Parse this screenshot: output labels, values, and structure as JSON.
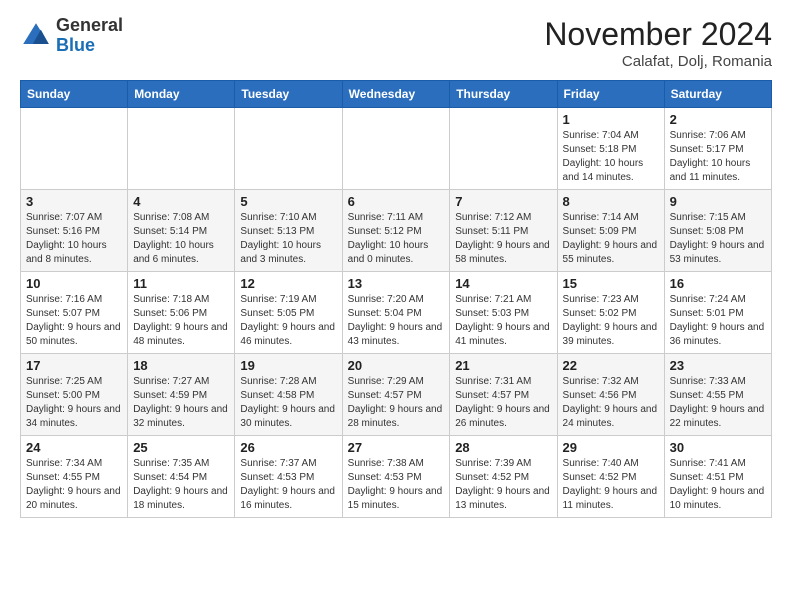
{
  "header": {
    "logo_general": "General",
    "logo_blue": "Blue",
    "month_year": "November 2024",
    "location": "Calafat, Dolj, Romania"
  },
  "days_of_week": [
    "Sunday",
    "Monday",
    "Tuesday",
    "Wednesday",
    "Thursday",
    "Friday",
    "Saturday"
  ],
  "weeks": [
    [
      {
        "day": "",
        "info": ""
      },
      {
        "day": "",
        "info": ""
      },
      {
        "day": "",
        "info": ""
      },
      {
        "day": "",
        "info": ""
      },
      {
        "day": "",
        "info": ""
      },
      {
        "day": "1",
        "info": "Sunrise: 7:04 AM\nSunset: 5:18 PM\nDaylight: 10 hours and 14 minutes."
      },
      {
        "day": "2",
        "info": "Sunrise: 7:06 AM\nSunset: 5:17 PM\nDaylight: 10 hours and 11 minutes."
      }
    ],
    [
      {
        "day": "3",
        "info": "Sunrise: 7:07 AM\nSunset: 5:16 PM\nDaylight: 10 hours and 8 minutes."
      },
      {
        "day": "4",
        "info": "Sunrise: 7:08 AM\nSunset: 5:14 PM\nDaylight: 10 hours and 6 minutes."
      },
      {
        "day": "5",
        "info": "Sunrise: 7:10 AM\nSunset: 5:13 PM\nDaylight: 10 hours and 3 minutes."
      },
      {
        "day": "6",
        "info": "Sunrise: 7:11 AM\nSunset: 5:12 PM\nDaylight: 10 hours and 0 minutes."
      },
      {
        "day": "7",
        "info": "Sunrise: 7:12 AM\nSunset: 5:11 PM\nDaylight: 9 hours and 58 minutes."
      },
      {
        "day": "8",
        "info": "Sunrise: 7:14 AM\nSunset: 5:09 PM\nDaylight: 9 hours and 55 minutes."
      },
      {
        "day": "9",
        "info": "Sunrise: 7:15 AM\nSunset: 5:08 PM\nDaylight: 9 hours and 53 minutes."
      }
    ],
    [
      {
        "day": "10",
        "info": "Sunrise: 7:16 AM\nSunset: 5:07 PM\nDaylight: 9 hours and 50 minutes."
      },
      {
        "day": "11",
        "info": "Sunrise: 7:18 AM\nSunset: 5:06 PM\nDaylight: 9 hours and 48 minutes."
      },
      {
        "day": "12",
        "info": "Sunrise: 7:19 AM\nSunset: 5:05 PM\nDaylight: 9 hours and 46 minutes."
      },
      {
        "day": "13",
        "info": "Sunrise: 7:20 AM\nSunset: 5:04 PM\nDaylight: 9 hours and 43 minutes."
      },
      {
        "day": "14",
        "info": "Sunrise: 7:21 AM\nSunset: 5:03 PM\nDaylight: 9 hours and 41 minutes."
      },
      {
        "day": "15",
        "info": "Sunrise: 7:23 AM\nSunset: 5:02 PM\nDaylight: 9 hours and 39 minutes."
      },
      {
        "day": "16",
        "info": "Sunrise: 7:24 AM\nSunset: 5:01 PM\nDaylight: 9 hours and 36 minutes."
      }
    ],
    [
      {
        "day": "17",
        "info": "Sunrise: 7:25 AM\nSunset: 5:00 PM\nDaylight: 9 hours and 34 minutes."
      },
      {
        "day": "18",
        "info": "Sunrise: 7:27 AM\nSunset: 4:59 PM\nDaylight: 9 hours and 32 minutes."
      },
      {
        "day": "19",
        "info": "Sunrise: 7:28 AM\nSunset: 4:58 PM\nDaylight: 9 hours and 30 minutes."
      },
      {
        "day": "20",
        "info": "Sunrise: 7:29 AM\nSunset: 4:57 PM\nDaylight: 9 hours and 28 minutes."
      },
      {
        "day": "21",
        "info": "Sunrise: 7:31 AM\nSunset: 4:57 PM\nDaylight: 9 hours and 26 minutes."
      },
      {
        "day": "22",
        "info": "Sunrise: 7:32 AM\nSunset: 4:56 PM\nDaylight: 9 hours and 24 minutes."
      },
      {
        "day": "23",
        "info": "Sunrise: 7:33 AM\nSunset: 4:55 PM\nDaylight: 9 hours and 22 minutes."
      }
    ],
    [
      {
        "day": "24",
        "info": "Sunrise: 7:34 AM\nSunset: 4:55 PM\nDaylight: 9 hours and 20 minutes."
      },
      {
        "day": "25",
        "info": "Sunrise: 7:35 AM\nSunset: 4:54 PM\nDaylight: 9 hours and 18 minutes."
      },
      {
        "day": "26",
        "info": "Sunrise: 7:37 AM\nSunset: 4:53 PM\nDaylight: 9 hours and 16 minutes."
      },
      {
        "day": "27",
        "info": "Sunrise: 7:38 AM\nSunset: 4:53 PM\nDaylight: 9 hours and 15 minutes."
      },
      {
        "day": "28",
        "info": "Sunrise: 7:39 AM\nSunset: 4:52 PM\nDaylight: 9 hours and 13 minutes."
      },
      {
        "day": "29",
        "info": "Sunrise: 7:40 AM\nSunset: 4:52 PM\nDaylight: 9 hours and 11 minutes."
      },
      {
        "day": "30",
        "info": "Sunrise: 7:41 AM\nSunset: 4:51 PM\nDaylight: 9 hours and 10 minutes."
      }
    ]
  ]
}
